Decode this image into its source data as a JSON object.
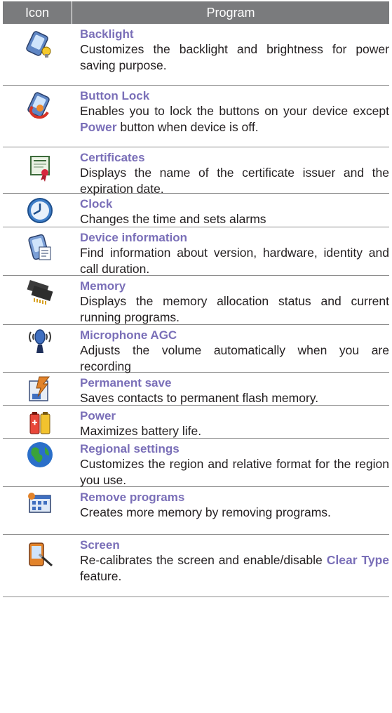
{
  "header": {
    "icon_col": "Icon",
    "program_col": "Program"
  },
  "rows": [
    {
      "icon": "backlight-icon",
      "title": "Backlight",
      "desc": [
        "Customizes the backlight and brightness for power saving purpose."
      ]
    },
    {
      "icon": "button-lock-icon",
      "title": "Button Lock",
      "desc": [
        "Enables you to lock the buttons on your device except ",
        "Power",
        " button when device is off."
      ]
    },
    {
      "icon": "certificates-icon",
      "title": "Certificates",
      "desc": [
        "Displays the name of the certificate issuer and the expiration date."
      ]
    },
    {
      "icon": "clock-icon",
      "title": "Clock",
      "desc": [
        "Changes the time and sets alarms"
      ]
    },
    {
      "icon": "device-information-icon",
      "title": "Device information",
      "desc": [
        "Find information about version, hardware, identity and call duration."
      ]
    },
    {
      "icon": "memory-icon",
      "title": "Memory",
      "desc": [
        "Displays the memory allocation status and current running programs."
      ]
    },
    {
      "icon": "microphone-icon",
      "title": "Microphone AGC",
      "desc": [
        "Adjusts the volume automatically when you are recording"
      ]
    },
    {
      "icon": "permanent-save-icon",
      "title": "Permanent save",
      "desc": [
        "Saves contacts to permanent flash memory."
      ]
    },
    {
      "icon": "power-icon",
      "title": "Power",
      "desc": [
        "Maximizes battery life."
      ]
    },
    {
      "icon": "globe-icon",
      "title": "Regional settings",
      "desc": [
        "Customizes the region and relative format for the region you use."
      ]
    },
    {
      "icon": "remove-programs-icon",
      "title": "Remove programs",
      "desc": [
        "Creates more memory by removing programs."
      ]
    },
    {
      "icon": "screen-icon",
      "title": "Screen",
      "desc": [
        "Re-calibrates the screen and enable/disable ",
        "Clear Type",
        " feature."
      ]
    }
  ]
}
